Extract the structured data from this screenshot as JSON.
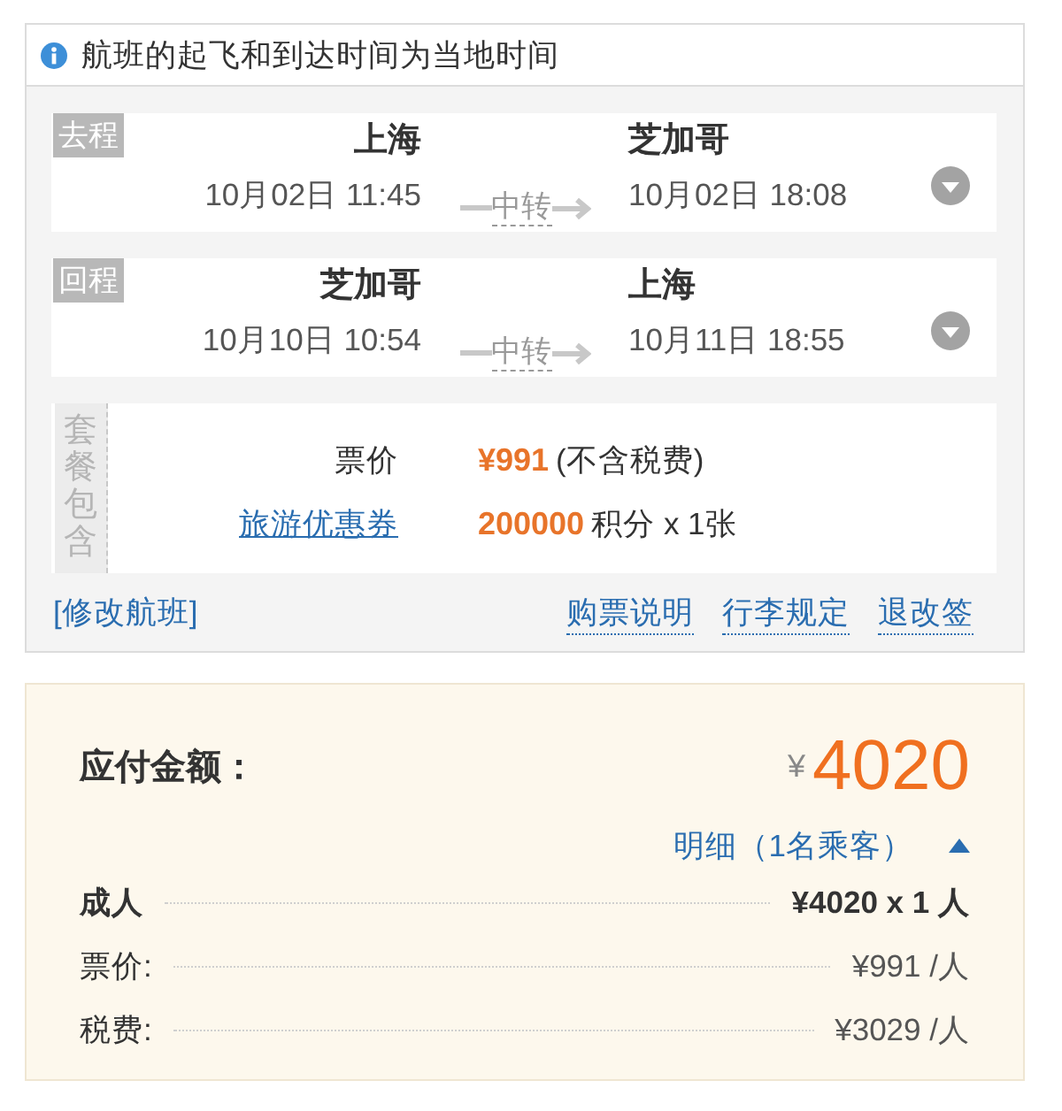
{
  "notice": {
    "text": "航班的起飞和到达时间为当地时间"
  },
  "segments": [
    {
      "tag": "去程",
      "departure": {
        "city": "上海",
        "time": "10月02日 11:45"
      },
      "transfer": "中转",
      "arrival": {
        "city": "芝加哥",
        "time": "10月02日 18:08"
      }
    },
    {
      "tag": "回程",
      "departure": {
        "city": "芝加哥",
        "time": "10月10日 10:54"
      },
      "transfer": "中转",
      "arrival": {
        "city": "上海",
        "time": "10月11日 18:55"
      }
    }
  ],
  "package": {
    "label": "套餐包含",
    "rows": [
      {
        "kind": "text",
        "label": "票价",
        "value": "¥991",
        "note": "(不含税费)"
      },
      {
        "kind": "link",
        "label": "旅游优惠券",
        "value": "200000",
        "note": "积分 x 1张"
      }
    ]
  },
  "links": {
    "modify": "[修改航班]",
    "right": [
      "购票说明",
      "行李规定",
      "退改签"
    ]
  },
  "payment": {
    "label": "应付金额：",
    "currency": "¥",
    "amount": "4020",
    "details": {
      "label": "明细（1名乘客）",
      "expanded": true
    },
    "breakdown": [
      {
        "kind": "group",
        "label": "成人",
        "value": "¥4020 x 1 人"
      },
      {
        "kind": "item",
        "label": "票价:",
        "value": "¥991 /人"
      },
      {
        "kind": "item",
        "label": "税费:",
        "value": "¥3029 /人"
      }
    ]
  }
}
